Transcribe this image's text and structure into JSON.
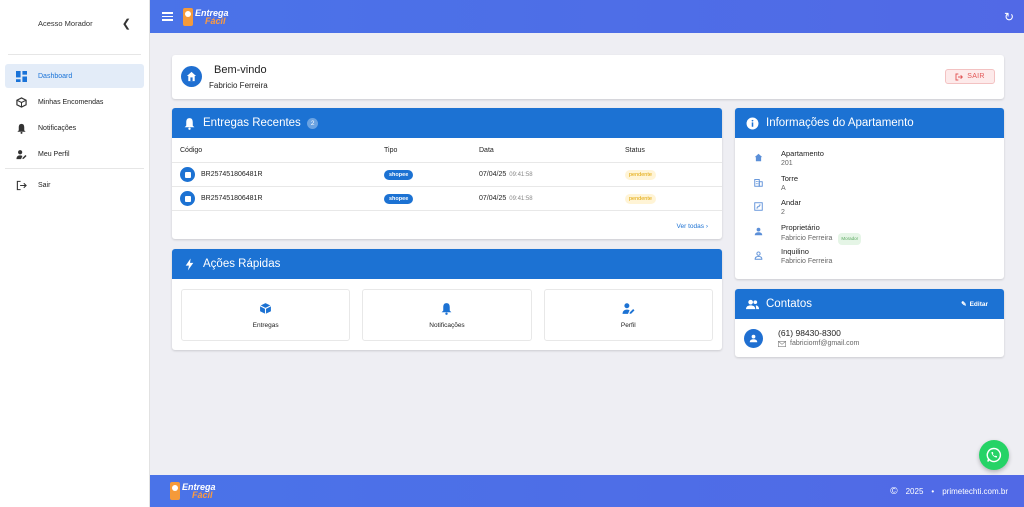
{
  "sidebar": {
    "title": "Acesso Morador",
    "items": [
      {
        "label": "Dashboard",
        "icon": "dashboard-icon",
        "active": true
      },
      {
        "label": "Minhas Encomendas",
        "icon": "package-icon"
      },
      {
        "label": "Notificações",
        "icon": "bell-icon"
      },
      {
        "label": "Meu Perfil",
        "icon": "user-edit-icon"
      }
    ],
    "logout_label": "Sair"
  },
  "topbar": {
    "logo_line1": "Entrega",
    "logo_line2": "Fácil"
  },
  "welcome": {
    "title": "Bem-vindo",
    "name": "Fabricio Ferreira",
    "logout_label": "SAIR"
  },
  "entregas": {
    "title": "Entregas Recentes",
    "count": "2",
    "columns": [
      "Código",
      "Tipo",
      "Data",
      "Status"
    ],
    "rows": [
      {
        "code": "BR257451806481R",
        "type": "shopee",
        "date": "07/04/25",
        "time": "09:41:58",
        "status": "pendente"
      },
      {
        "code": "BR257451806481R",
        "type": "shopee",
        "date": "07/04/25",
        "time": "09:41:58",
        "status": "pendente"
      }
    ],
    "view_all": "Ver todas"
  },
  "acoes": {
    "title": "Ações Rápidas",
    "items": [
      {
        "label": "Entregas",
        "icon": "box-icon"
      },
      {
        "label": "Notificações",
        "icon": "bell-icon"
      },
      {
        "label": "Perfil",
        "icon": "user-edit-icon"
      }
    ]
  },
  "info": {
    "title": "Informações do Apartamento",
    "rows": [
      {
        "label": "Apartamento",
        "value": "201",
        "icon": "home-icon"
      },
      {
        "label": "Torre",
        "value": "A",
        "icon": "building-icon"
      },
      {
        "label": "Andar",
        "value": "2",
        "icon": "floor-icon"
      },
      {
        "label": "Proprietário",
        "value": "Fabricio Ferreira",
        "icon": "person-icon",
        "badge": "Morador"
      },
      {
        "label": "Inquilino",
        "value": "Fabricio Ferreira",
        "icon": "person-outline-icon"
      }
    ]
  },
  "contatos": {
    "title": "Contatos",
    "edit_label": "Editar",
    "phone": "(61) 98430-8300",
    "email": "fabriciomf@gmail.com"
  },
  "footer": {
    "logo_line1": "Entrega",
    "logo_line2": "Fácil",
    "year": "2025",
    "site": "primetechti.com.br"
  },
  "colors": {
    "primary": "#1c72d3",
    "topbar": "#4a73e8",
    "whatsapp": "#25d366",
    "danger": "#e25656"
  }
}
